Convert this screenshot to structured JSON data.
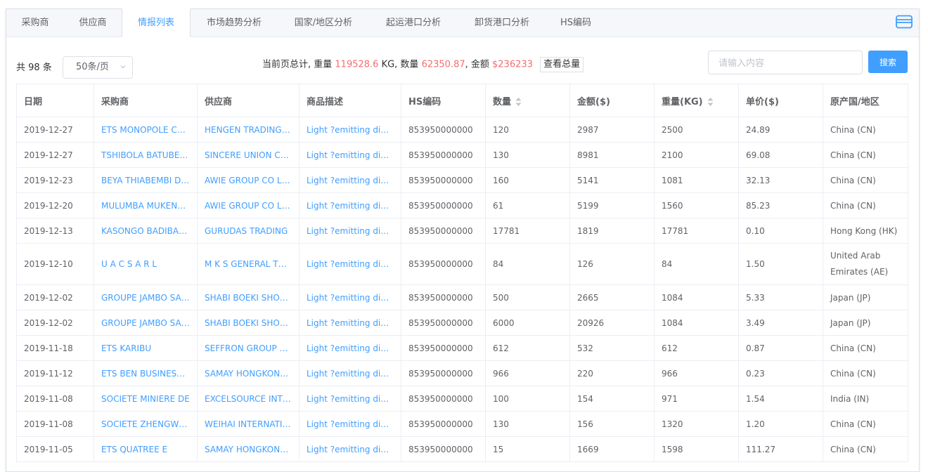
{
  "tabs": [
    {
      "label": "采购商",
      "active": false
    },
    {
      "label": "供应商",
      "active": false
    },
    {
      "label": "情报列表",
      "active": true
    },
    {
      "label": "市场趋势分析",
      "active": false
    },
    {
      "label": "国家/地区分析",
      "active": false
    },
    {
      "label": "起运港口分析",
      "active": false
    },
    {
      "label": "卸货港口分析",
      "active": false
    },
    {
      "label": "HS编码",
      "active": false
    }
  ],
  "toolbar": {
    "total_label": "共 98 条",
    "page_size": "50条/页",
    "summary_prefix": "当前页总计, 重量 ",
    "weight_value": "119528.6",
    "weight_unit": " KG, 数量 ",
    "quantity_value": "62350.87",
    "amount_label": ", 金额 ",
    "amount_value": "$236233",
    "view_total_label": "查看总量",
    "search_placeholder": "请输入内容",
    "search_label": "搜索"
  },
  "table": {
    "columns": [
      "日期",
      "采购商",
      "供应商",
      "商品描述",
      "HS编码",
      "数量",
      "金额($)",
      "重量(KG)",
      "单价($)",
      "原产国/地区"
    ],
    "rows": [
      [
        "2019-12-27",
        "ETS MONOPOLE CO SARL",
        "HENGEN TRADING CO LTD",
        "Light ?emitting diodes",
        "853950000000",
        "120",
        "2987",
        "2500",
        "24.89",
        "China (CN)"
      ],
      [
        "2019-12-27",
        "TSHIBOLA BATUBENGA",
        "SINCERE UNION CO LTD",
        "Light ?emitting diodes",
        "853950000000",
        "130",
        "8981",
        "2100",
        "69.08",
        "China (CN)"
      ],
      [
        "2019-12-23",
        "BEYA THIABEMBI DJANI",
        "AWIE GROUP CO LIMITED",
        "Light ?emitting diodes",
        "853950000000",
        "160",
        "5141",
        "1081",
        "32.13",
        "China (CN)"
      ],
      [
        "2019-12-20",
        "MULUMBA MUKENDI JEAN",
        "AWIE GROUP CO LIMITED",
        "Light ?emitting diodes",
        "853950000000",
        "61",
        "5199",
        "1560",
        "85.23",
        "China (CN)"
      ],
      [
        "2019-12-13",
        "KASONGO BADIBANGA",
        "GURUDAS TRADING",
        "Light ?emitting diodes",
        "853950000000",
        "17781",
        "1819",
        "17781",
        "0.10",
        "Hong Kong (HK)"
      ],
      [
        "2019-12-10",
        "U A C S A R L",
        "M K S GENERAL TRADING",
        "Light ?emitting diodes",
        "853950000000",
        "84",
        "126",
        "84",
        "1.50",
        "United Arab Emirates (AE)"
      ],
      [
        "2019-12-02",
        "GROUPE JAMBO SARL",
        "SHABI BOEKI SHOKAI",
        "Light ?emitting diodes",
        "853950000000",
        "500",
        "2665",
        "1084",
        "5.33",
        "Japan (JP)"
      ],
      [
        "2019-12-02",
        "GROUPE JAMBO SARL",
        "SHABI BOEKI SHOKAI",
        "Light ?emitting diodes",
        "853950000000",
        "6000",
        "20926",
        "1084",
        "3.49",
        "Japan (JP)"
      ],
      [
        "2019-11-18",
        "ETS KARIBU",
        "SEFFRON GROUP LIMITED",
        "Light ?emitting diodes",
        "853950000000",
        "612",
        "532",
        "612",
        "0.87",
        "China (CN)"
      ],
      [
        "2019-11-12",
        "ETS BEN BUSINESS SARL",
        "SAMAY HONGKONG LIMITED",
        "Light ?emitting diodes",
        "853950000000",
        "966",
        "220",
        "966",
        "0.23",
        "China (CN)"
      ],
      [
        "2019-11-08",
        "SOCIETE MINIERE DE",
        "EXCELSOURCE INTERNATIONAL",
        "Light ?emitting diodes",
        "853950000000",
        "100",
        "154",
        "971",
        "1.54",
        "India (IN)"
      ],
      [
        "2019-11-08",
        "SOCIETE ZHENGWEI SARL",
        "WEIHAI INTERNATIONAL",
        "Light ?emitting diodes",
        "853950000000",
        "130",
        "156",
        "1320",
        "1.20",
        "China (CN)"
      ],
      [
        "2019-11-05",
        "ETS QUATREE E",
        "SAMAY HONGKONG LIMITED",
        "Light ?emitting diodes",
        "853950000000",
        "15",
        "1669",
        "1598",
        "111.27",
        "China (CN)"
      ]
    ]
  },
  "colors": {
    "accent": "#409eff",
    "highlight": "#f56c6c",
    "border": "#ebeef5"
  }
}
